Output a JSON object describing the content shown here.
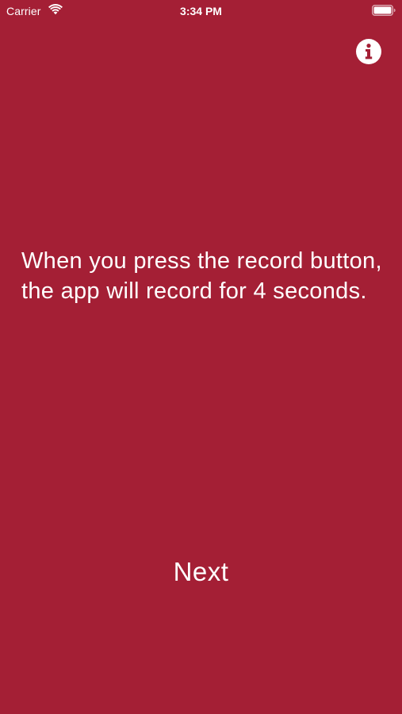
{
  "status_bar": {
    "carrier": "Carrier",
    "time": "3:34 PM",
    "wifi_icon": "wifi-icon",
    "battery_icon": "battery-icon"
  },
  "header": {
    "info_icon": "info-icon"
  },
  "main": {
    "instruction_text": "When you press the record button, the app will record for 4 seconds."
  },
  "footer": {
    "next_label": "Next"
  },
  "colors": {
    "background": "#a41f35",
    "text": "#ffffff"
  }
}
